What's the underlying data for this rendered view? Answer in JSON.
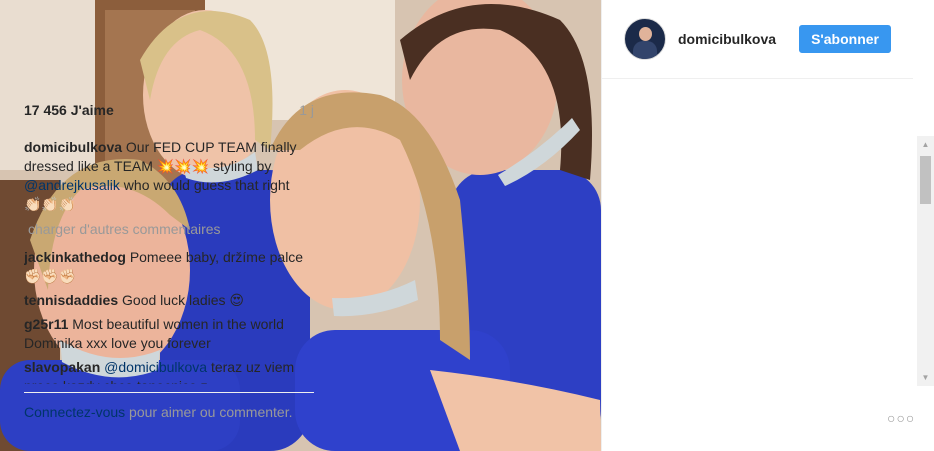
{
  "header": {
    "username": "domicibulkova",
    "follow_label": "S'abonner"
  },
  "stats": {
    "likes": "17 456 J'aime",
    "time": "1 j"
  },
  "caption": {
    "user": "domicibulkova",
    "text_1": "Our FED CUP TEAM finally dressed like a TEAM 💥💥💥 styling by ",
    "mention": "@andrejkusalik",
    "text_2": " who would guess that right 👏🏻👏🏻👏🏻"
  },
  "load_more": "charger d'autres commentaires",
  "comments": [
    {
      "user": "jackinkathedog",
      "text": "Pomeee baby, držíme palce✊🏻✊🏻✊🏻"
    },
    {
      "user": "tennisdaddies",
      "text": "Good luck ladies 😍"
    },
    {
      "user": "g25r11",
      "text": "Most beautiful women in the world Dominika xxx love you forever"
    },
    {
      "user": "slavopakan",
      "mention": "@domicibulkova",
      "text": "teraz uz viem preco kazdy chce tanecnice z"
    }
  ],
  "footer": {
    "login_link": "Connectez-vous",
    "login_rest": " pour aimer ou commenter.",
    "more_icon": "ellipsis-icon"
  },
  "photo": {
    "description_icon": "post-photo",
    "dress_color": "#2d3fc4"
  }
}
